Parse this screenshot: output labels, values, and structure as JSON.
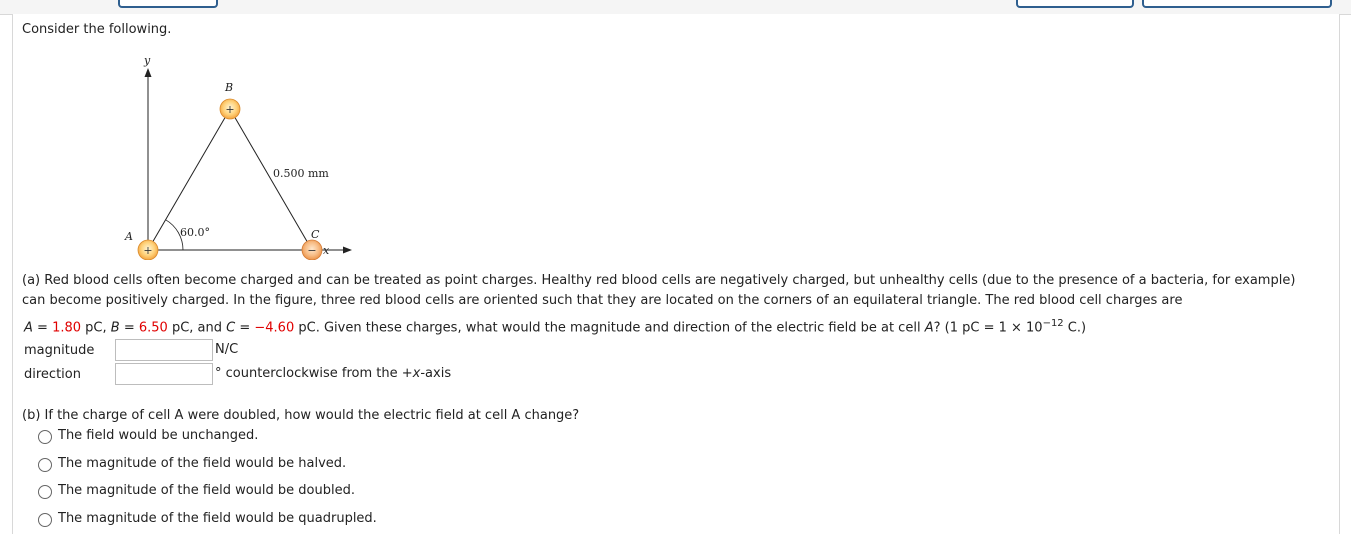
{
  "intro": "Consider the following.",
  "figure": {
    "y_axis_label": "y",
    "x_axis_label": "x",
    "label_a": "A",
    "label_b": "B",
    "label_c": "C",
    "angle_label": "60.0°",
    "side_label": "0.500 mm",
    "sign_a": "+",
    "sign_b": "+",
    "sign_c": "−"
  },
  "part_a": {
    "line1": "(a) Red blood cells often become charged and can be treated as point charges. Healthy red blood cells are negatively charged, but unhealthy cells (due to the presence of a bacteria, for example)",
    "line2": "can become positively charged. In the figure, three red blood cells are oriented such that they are located on the corners of an equilateral triangle. The red blood cell charges are",
    "var_a": "A",
    "eq1": " = ",
    "val_a": "1.80",
    "unit1": " pC, ",
    "var_b": "B",
    "eq2": " = ",
    "val_b": "6.50",
    "unit2": " pC,  and  ",
    "var_c": "C",
    "eq3": " = ",
    "val_c": "−4.60",
    "rest": " pC.  Given these charges, what would the magnitude and direction of the electric field be at cell ",
    "cell_a": "A",
    "tail": "? (1 pC = 1 × 10",
    "exp": "−12",
    "tail2": " C.)",
    "magnitude_label": "magnitude",
    "magnitude_value": "",
    "magnitude_unit": "N/C",
    "direction_label": "direction",
    "direction_value": "",
    "direction_unit_prefix": "° counterclockwise from the +",
    "direction_unit_var": "x",
    "direction_unit_suffix": "-axis"
  },
  "part_b": {
    "question": "(b) If the charge of cell A were doubled, how would the electric field at cell A change?",
    "options": [
      "The field would be unchanged.",
      "The magnitude of the field would be halved.",
      "The magnitude of the field would be doubled.",
      "The magnitude of the field would be quadrupled."
    ]
  }
}
